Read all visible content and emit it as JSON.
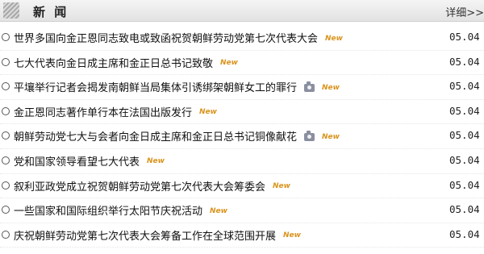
{
  "header": {
    "title": "新  闻",
    "more_label": "详细>>"
  },
  "colors": {
    "new_badge": "#d9941e",
    "header_bg": "#e8e8e8"
  },
  "news": [
    {
      "title": "世界多国向金正恩同志致电或致函祝贺朝鲜劳动党第七次代表大会",
      "camera": false,
      "badge": "New",
      "date": "05.04"
    },
    {
      "title": "七大代表向金日成主席和金正日总书记致敬",
      "camera": false,
      "badge": "New",
      "date": "05.04"
    },
    {
      "title": "平壤举行记者会揭发南朝鲜当局集体引诱绑架朝鲜女工的罪行",
      "camera": true,
      "badge": "New",
      "date": "05.04"
    },
    {
      "title": "金正恩同志著作单行本在法国出版发行",
      "camera": false,
      "badge": "New",
      "date": "05.04"
    },
    {
      "title": "朝鲜劳动党七大与会者向金日成主席和金正日总书记铜像献花",
      "camera": true,
      "badge": "New",
      "date": "05.04"
    },
    {
      "title": "党和国家领导看望七大代表",
      "camera": false,
      "badge": "New",
      "date": "05.04"
    },
    {
      "title": "叙利亚政党成立祝贺朝鲜劳动党第七次代表大会筹委会",
      "camera": false,
      "badge": "New",
      "date": "05.04"
    },
    {
      "title": "一些国家和国际组织举行太阳节庆祝活动",
      "camera": false,
      "badge": "New",
      "date": "05.04"
    },
    {
      "title": "庆祝朝鲜劳动党第七次代表大会筹备工作在全球范围开展",
      "camera": false,
      "badge": "New",
      "date": "05.04"
    }
  ]
}
